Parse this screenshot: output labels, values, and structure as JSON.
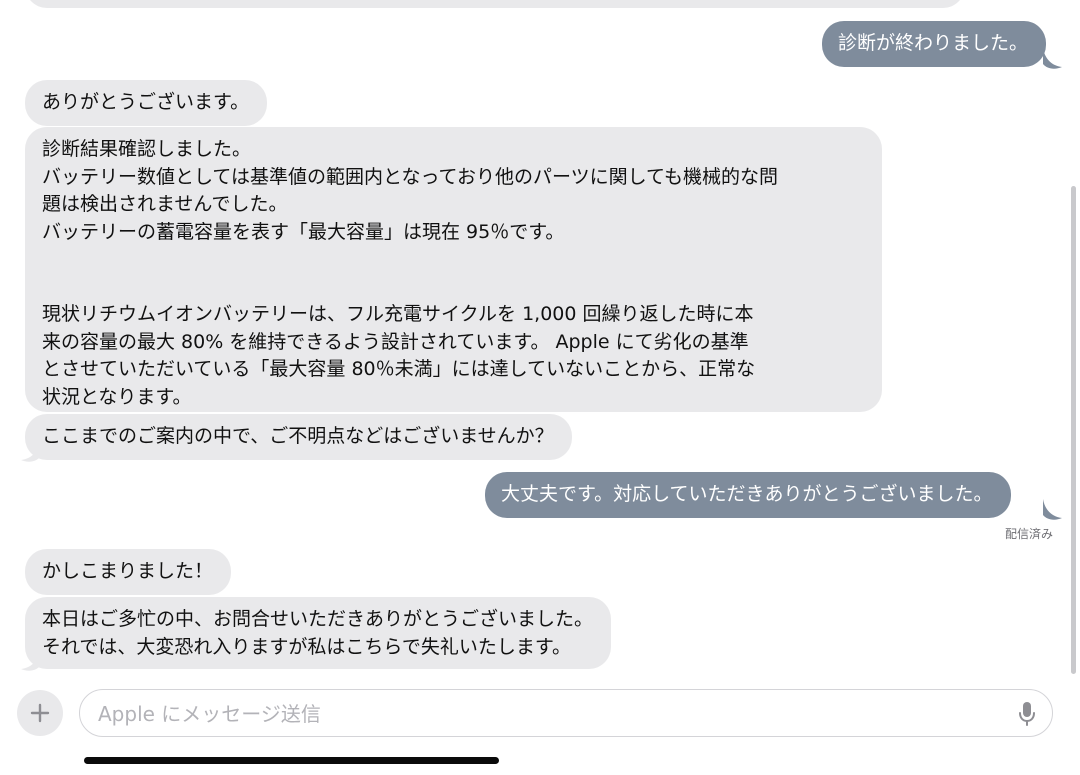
{
  "thread": {
    "messages": [
      {
        "id": "m1",
        "side": "out",
        "text": "診断が終わりました。"
      },
      {
        "id": "m2",
        "side": "in",
        "text": "ありがとうございます。"
      },
      {
        "id": "m3",
        "side": "in",
        "text": "診断結果確認しました。\nバッテリー数値としては基準値の範囲内となっており他のパーツに関しても機械的な問\n題は検出されませんでした。\nバッテリーの蓄電容量を表す「最大容量」は現在 95％です。\n\n\n現状リチウムイオンバッテリーは、フル充電サイクルを 1,000 回繰り返した時に本\n来の容量の最大 80% を維持できるよう設計されています。 Apple にて劣化の基準\nとさせていただいている「最大容量 80％未満」には達していないことから、正常な\n状況となります。"
      },
      {
        "id": "m4",
        "side": "in",
        "text": "ここまでのご案内の中で、ご不明点などはございませんか？"
      },
      {
        "id": "m5",
        "side": "out",
        "text": "大丈夫です。対応していただきありがとうございました。"
      },
      {
        "id": "m6",
        "side": "in",
        "text": "かしこまりました！"
      },
      {
        "id": "m7",
        "side": "in",
        "text": "本日はご多忙の中、お問合せいただきありがとうございました。\nそれでは、大変恐れ入りますが私はこちらで失礼いたします。"
      }
    ],
    "delivered_label": "配信済み"
  },
  "composer": {
    "placeholder": "Apple にメッセージ送信",
    "value": "",
    "plus_icon": "plus-icon",
    "mic_icon": "microphone-icon"
  },
  "colors": {
    "incoming_bubble": "#e9e9eb",
    "outgoing_bubble": "#7f8c9c",
    "placeholder": "#b3b3b8"
  }
}
